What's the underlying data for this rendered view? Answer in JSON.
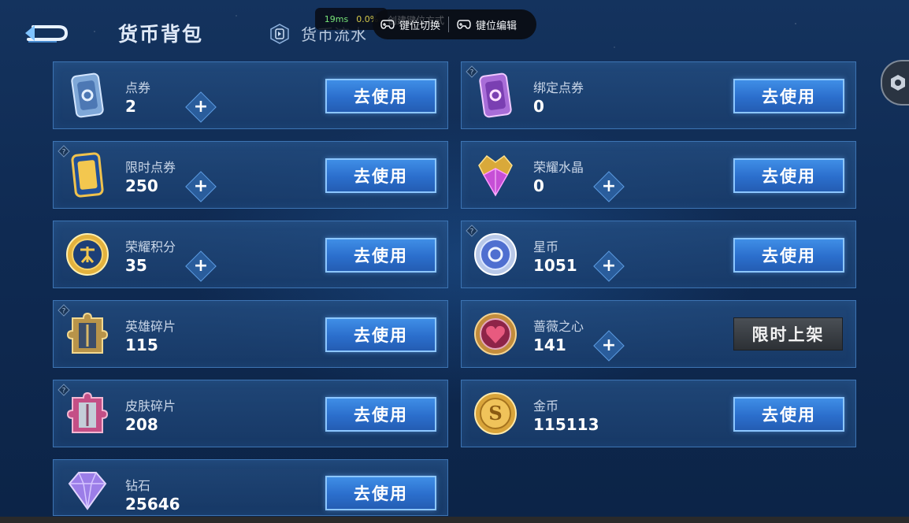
{
  "header": {
    "title": "货币背包",
    "flow_tab": "货币流水"
  },
  "overlay": {
    "ping": "19ms",
    "loss": "0.0%",
    "faded_hint": "创建键位方式",
    "switch_label": "键位切换",
    "edit_label": "键位编辑"
  },
  "items": [
    {
      "name": "点券",
      "count": "2",
      "button": "去使用",
      "icon": "coupon-icon",
      "has_add": true,
      "has_info": false
    },
    {
      "name": "绑定点券",
      "count": "0",
      "button": "去使用",
      "icon": "bound-coupon-icon",
      "has_add": false,
      "has_info": true
    },
    {
      "name": "限时点券",
      "count": "250",
      "button": "去使用",
      "icon": "limited-coupon-icon",
      "has_add": true,
      "has_info": true
    },
    {
      "name": "荣耀水晶",
      "count": "0",
      "button": "去使用",
      "icon": "glory-crystal-icon",
      "has_add": true,
      "has_info": false
    },
    {
      "name": "荣耀积分",
      "count": "35",
      "button": "去使用",
      "icon": "glory-points-icon",
      "has_add": true,
      "has_info": false
    },
    {
      "name": "星币",
      "count": "1051",
      "button": "去使用",
      "icon": "star-coin-icon",
      "has_add": true,
      "has_info": true
    },
    {
      "name": "英雄碎片",
      "count": "115",
      "button": "去使用",
      "icon": "hero-fragment-icon",
      "has_add": false,
      "has_info": true
    },
    {
      "name": "蔷薇之心",
      "count": "141",
      "button": "限时上架",
      "icon": "rose-heart-icon",
      "has_add": true,
      "has_info": false
    },
    {
      "name": "皮肤碎片",
      "count": "208",
      "button": "去使用",
      "icon": "skin-fragment-icon",
      "has_add": false,
      "has_info": true
    },
    {
      "name": "金币",
      "count": "115113",
      "button": "去使用",
      "icon": "gold-coin-icon",
      "has_add": false,
      "has_info": false
    },
    {
      "name": "钻石",
      "count": "25646",
      "button": "去使用",
      "icon": "diamond-icon",
      "has_add": false,
      "has_info": false
    }
  ],
  "colors": {
    "use_button": "#2b6ecc",
    "card_border": "#3d74b3",
    "limited_tag": "#3a3e44"
  }
}
